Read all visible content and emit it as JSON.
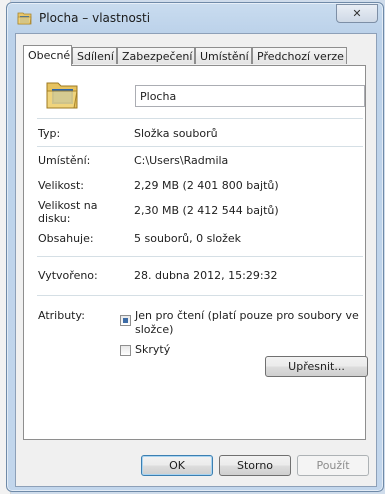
{
  "window": {
    "title": "Plocha – vlastnosti",
    "close_glyph": "✕"
  },
  "tabs": [
    {
      "label": "Obecné",
      "active": true
    },
    {
      "label": "Sdílení",
      "active": false
    },
    {
      "label": "Zabezpečení",
      "active": false
    },
    {
      "label": "Umístění",
      "active": false
    },
    {
      "label": "Předchozí verze",
      "active": false
    }
  ],
  "general": {
    "name_value": "Plocha",
    "type_label": "Typ:",
    "type_value": "Složka souborů",
    "location_label": "Umístění:",
    "location_value": "C:\\Users\\Radmila",
    "size_label": "Velikost:",
    "size_value": "2,29 MB (2 401 800 bajtů)",
    "disk_size_label_1": "Velikost na",
    "disk_size_label_2": "disku:",
    "disk_size_value": "2,30 MB (2 412 544 bajtů)",
    "contains_label": "Obsahuje:",
    "contains_value": "5 souborů, 0 složek",
    "created_label": "Vytvořeno:",
    "created_value": "28. dubna 2012, 15:29:32",
    "attributes_label": "Atributy:",
    "readonly_label_1": "Jen pro čtení (platí pouze pro soubory ve",
    "readonly_label_2": "složce)",
    "readonly_state": "indeterminate",
    "hidden_label": "Skrytý",
    "hidden_state": "unchecked",
    "advanced_button": "Upřesnit..."
  },
  "footer": {
    "ok": "OK",
    "cancel": "Storno",
    "apply": "Použít"
  },
  "colors": {
    "accent": "#3d6ca6",
    "titlebar": "#bcd2ea",
    "panel": "#ffffff",
    "dialog": "#f0f0f0"
  },
  "icons": {
    "title": "folder-icon",
    "large": "folder-icon"
  }
}
